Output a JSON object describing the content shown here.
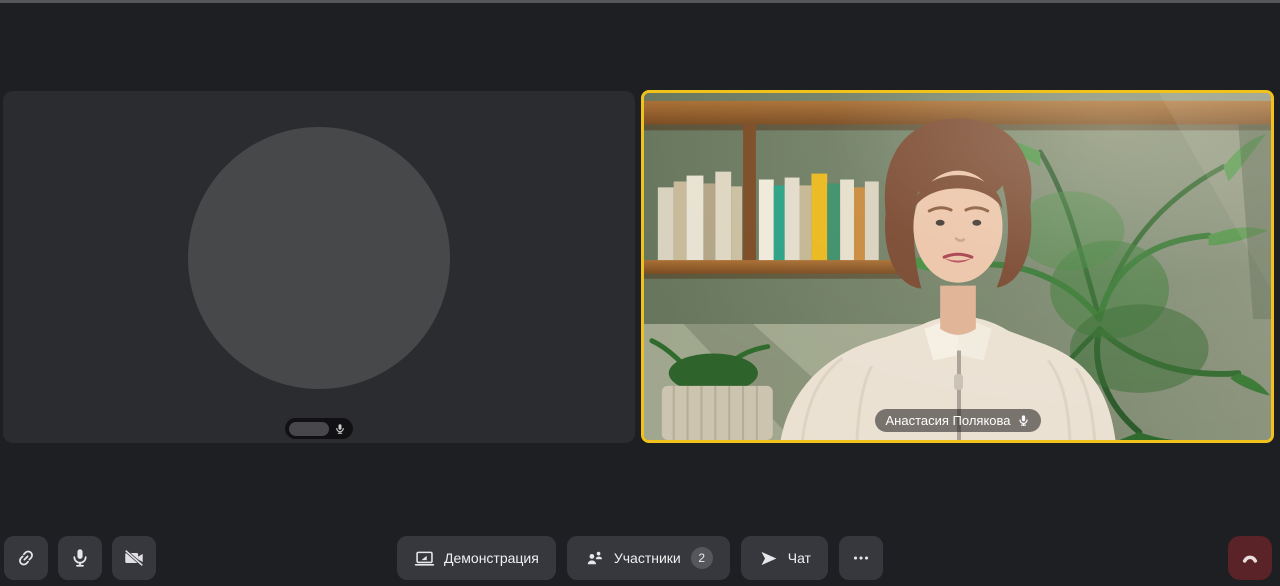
{
  "participants_grid": {
    "local_tile": {
      "avatar": "empty-avatar-circle",
      "name_hidden": true,
      "mic_indicator_icon": "mic-icon"
    },
    "active_tile": {
      "name": "Анастасия Полякова",
      "active_speaker": true,
      "mic_indicator_icon": "mic-icon"
    }
  },
  "toolbar": {
    "left": [
      {
        "icon": "invite-link-icon"
      },
      {
        "icon": "microphone-icon"
      },
      {
        "icon": "camera-off-icon"
      }
    ],
    "center": [
      {
        "icon": "screen-share-icon",
        "label": "Демонстрация"
      },
      {
        "icon": "participants-icon",
        "label": "Участники",
        "badge": "2"
      },
      {
        "icon": "send-plane-icon",
        "label": "Чат"
      },
      {
        "icon": "more-dots-icon"
      }
    ],
    "right": [
      {
        "icon": "hang-up-icon"
      }
    ]
  },
  "colors": {
    "background": "#1e1f22",
    "tile": "#2b2c2f",
    "button": "#37383d",
    "active_speaker_border": "#f1c21b",
    "hangup_background": "#5a2327",
    "badge": "#56575c"
  }
}
